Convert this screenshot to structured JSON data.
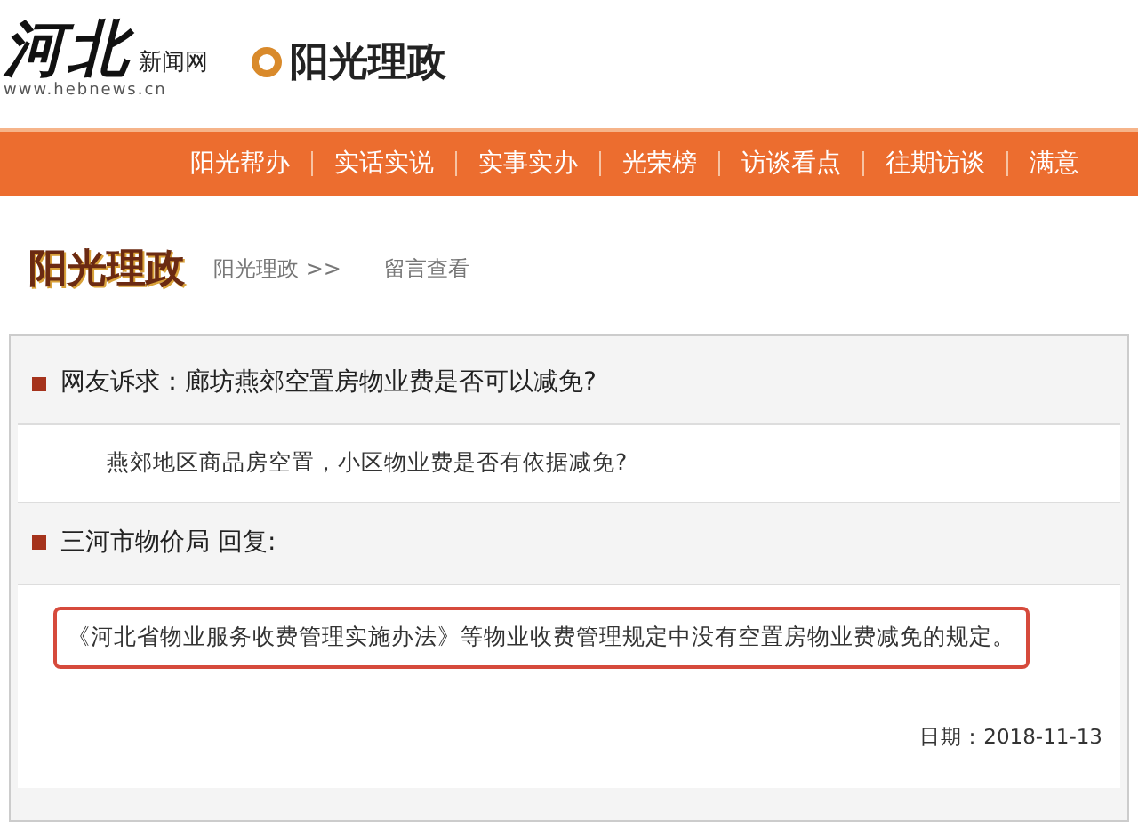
{
  "header": {
    "site_logo": "河北",
    "site_logo_sub": "新闻网",
    "site_url": "www.hebnews.cn",
    "channel_logo": "阳光理政"
  },
  "nav": [
    {
      "label": "阳光帮办"
    },
    {
      "label": "实话实说"
    },
    {
      "label": "实事实办"
    },
    {
      "label": "光荣榜"
    },
    {
      "label": "访谈看点"
    },
    {
      "label": "往期访谈"
    },
    {
      "label": "满意"
    }
  ],
  "breadcrumb": {
    "title": "阳光理政",
    "items": [
      "阳光理政 >>",
      "留言查看"
    ]
  },
  "sections": [
    {
      "heading": "网友诉求：廊坊燕郊空置房物业费是否可以减免?",
      "body": "燕郊地区商品房空置，小区物业费是否有依据减免?",
      "highlighted": false
    },
    {
      "heading": "三河市物价局 回复:",
      "body": "《河北省物业服务收费管理实施办法》等物业收费管理规定中没有空置房物业费减免的规定。",
      "highlighted": true
    }
  ],
  "date": "日期：2018-11-13"
}
